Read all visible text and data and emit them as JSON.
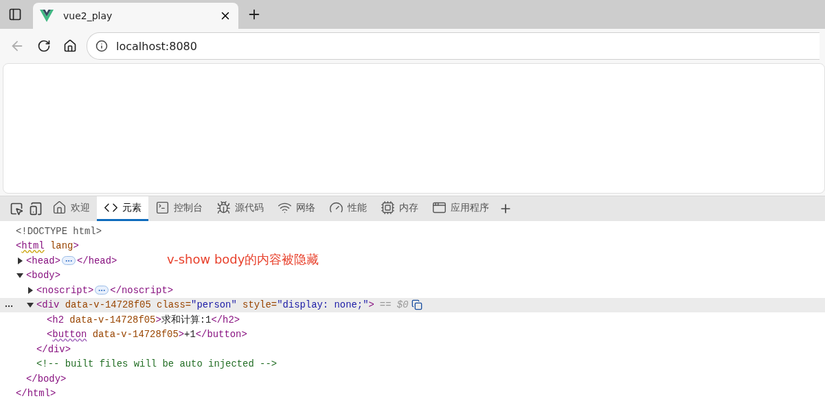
{
  "browser_tab": {
    "title": "vue2_play",
    "selected": true
  },
  "toolbar": {
    "back_enabled": false,
    "url": "localhost:8080"
  },
  "devtools_tabs": [
    {
      "label": "欢迎",
      "selected": false
    },
    {
      "label": "元素",
      "selected": true
    },
    {
      "label": "控制台",
      "selected": false
    },
    {
      "label": "源代码",
      "selected": false
    },
    {
      "label": "网络",
      "selected": false
    },
    {
      "label": "性能",
      "selected": false
    },
    {
      "label": "内存",
      "selected": false
    },
    {
      "label": "应用程序",
      "selected": false
    }
  ],
  "dom_tree": [
    {
      "tokens": [
        {
          "kind": "doctype",
          "text": "<!DOCTYPE html>"
        }
      ],
      "selected": false
    },
    {
      "tokens": [
        {
          "kind": "tag",
          "text": "<"
        },
        {
          "kind": "tag",
          "text": "html",
          "wavy_underline": true,
          "warning": true
        },
        {
          "kind": "attr",
          "text": " lang"
        },
        {
          "kind": "tag",
          "text": ">"
        }
      ],
      "selected": false,
      "close": [
        {
          "kind": "tag",
          "text": "</html>"
        }
      ],
      "children": [
        {
          "tokens": [
            {
              "kind": "tag",
              "text": "<head>"
            }
          ],
          "expanded": false,
          "selected": false,
          "close": [
            {
              "kind": "tag",
              "text": "</head>"
            }
          ]
        },
        {
          "tokens": [
            {
              "kind": "tag",
              "text": "<body>"
            }
          ],
          "expanded": true,
          "selected": false,
          "close": [
            {
              "kind": "tag",
              "text": "</body>"
            }
          ],
          "children": [
            {
              "tokens": [
                {
                  "kind": "tag",
                  "text": "<noscript>"
                }
              ],
              "expanded": false,
              "selected": false,
              "close": [
                {
                  "kind": "tag",
                  "text": "</noscript>"
                }
              ]
            },
            {
              "tokens": [
                {
                  "kind": "tag",
                  "text": "<div"
                },
                {
                  "kind": "attr",
                  "text": " data-v-14728f05 class="
                },
                {
                  "kind": "value",
                  "text": "\"person\""
                },
                {
                  "kind": "attr",
                  "text": " style="
                },
                {
                  "kind": "value",
                  "text": "\"display: none;\""
                },
                {
                  "kind": "tag",
                  "text": ">"
                }
              ],
              "expanded": true,
              "selected": true,
              "suffix": "== $0",
              "close": [
                {
                  "kind": "tag",
                  "text": "</div>"
                }
              ],
              "children": [
                {
                  "tokens": [
                    {
                      "kind": "tag",
                      "text": "<h2"
                    },
                    {
                      "kind": "attr",
                      "text": " data-v-14728f05"
                    },
                    {
                      "kind": "tag",
                      "text": ">"
                    },
                    {
                      "kind": "text",
                      "text": "求和计算:1"
                    },
                    {
                      "kind": "tag",
                      "text": "</h2>"
                    }
                  ],
                  "selected": false
                },
                {
                  "tokens": [
                    {
                      "kind": "tag",
                      "text": "<"
                    },
                    {
                      "kind": "tag",
                      "text": "button",
                      "wavy_underline": true,
                      "warning": false
                    },
                    {
                      "kind": "attr",
                      "text": " data-v-14728f05"
                    },
                    {
                      "kind": "tag",
                      "text": ">"
                    },
                    {
                      "kind": "text",
                      "text": "+1"
                    },
                    {
                      "kind": "tag",
                      "text": "</button>"
                    }
                  ],
                  "selected": false
                }
              ]
            },
            {
              "tokens": [
                {
                  "kind": "comment",
                  "text": "<!-- built files will be auto injected -->"
                }
              ],
              "selected": false
            }
          ]
        }
      ]
    }
  ],
  "annotation": "v-show body的内容被隐藏"
}
